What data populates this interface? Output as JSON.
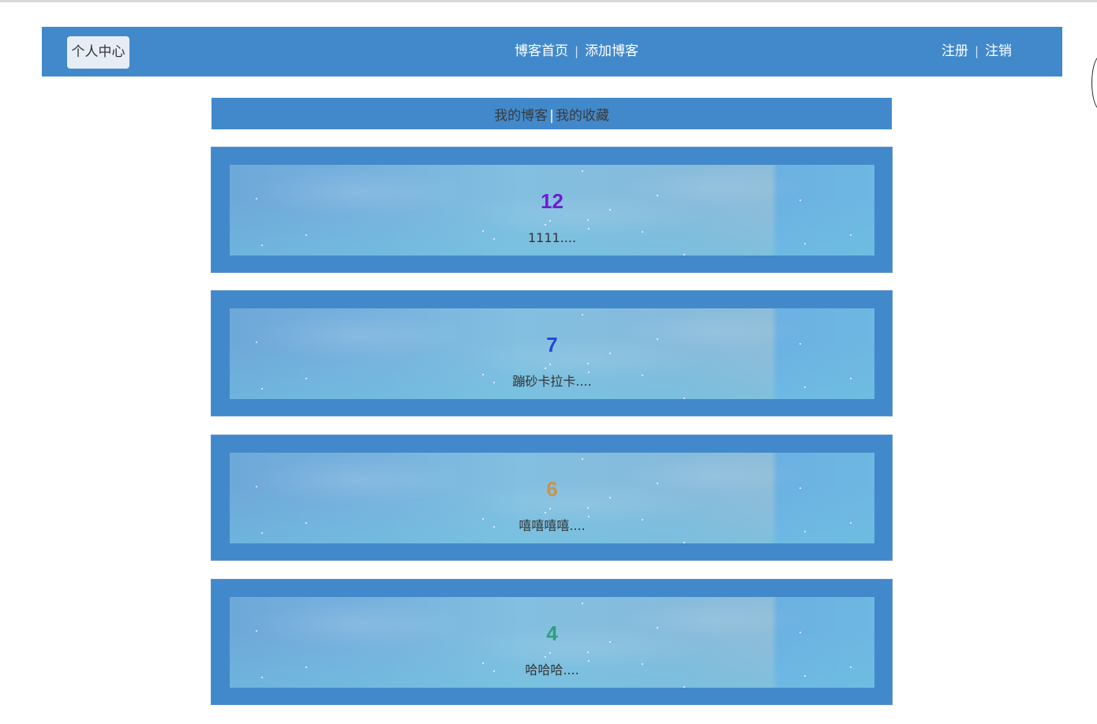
{
  "navbar": {
    "profile_label": "个人中心",
    "center_links": [
      "博客首页",
      "添加博客"
    ],
    "right_links": [
      "注册",
      "注销"
    ],
    "separator": "|"
  },
  "tabs": {
    "items": [
      "我的博客",
      "我的收藏"
    ],
    "separator": "|"
  },
  "posts": [
    {
      "number": "12",
      "excerpt": "1111....",
      "number_color": "#6a1fd0"
    },
    {
      "number": "7",
      "excerpt": "蹦砂卡拉卡....",
      "number_color": "#2348d6"
    },
    {
      "number": "6",
      "excerpt": "嘻嘻嘻嘻....",
      "number_color": "#c8944e"
    },
    {
      "number": "4",
      "excerpt": "哈哈哈....",
      "number_color": "#2f9e7e"
    }
  ],
  "colors": {
    "nav_bg": "#4289cb",
    "profile_btn_bg": "#e7edf6"
  }
}
